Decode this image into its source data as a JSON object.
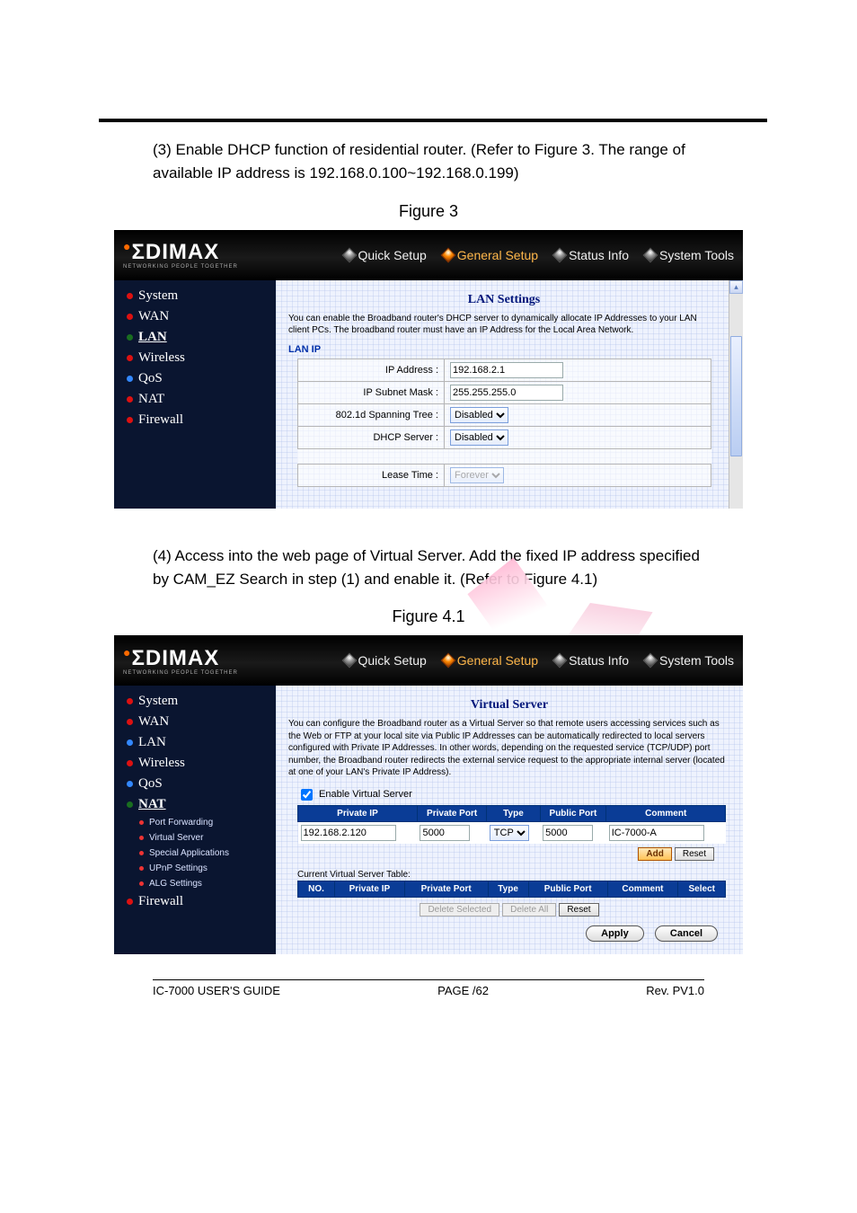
{
  "document": {
    "step3_text": "(3) Enable DHCP function of residential router. (Refer to Figure 3. The range of available IP address is 192.168.0.100~192.168.0.199)",
    "figure3_caption": "Figure 3",
    "step4_text": "(4) Access into the web page of Virtual Server. Add the fixed IP address specified by CAM_EZ Search in step (1) and enable it. (Refer to Figure 4.1)",
    "figure41_caption": "Figure 4.1",
    "footer_left": "IC-7000 USER'S GUIDE",
    "footer_center": "PAGE   /62",
    "footer_right": "Rev. PV1.0"
  },
  "router_common": {
    "logo_text": "ΣDIMAX",
    "logo_sub": "NETWORKING PEOPLE TOGETHER",
    "tabs": {
      "quick": "Quick Setup",
      "general": "General Setup",
      "status": "Status Info",
      "tools": "System Tools"
    },
    "nav": {
      "system": "System",
      "wan": "WAN",
      "lan": "LAN",
      "wireless": "Wireless",
      "qos": "QoS",
      "nat": "NAT",
      "firewall": "Firewall"
    }
  },
  "fig3": {
    "title": "LAN Settings",
    "desc": "You can enable the Broadband router's DHCP server to dynamically allocate IP Addresses to your LAN client PCs. The broadband router must have an IP Address for the Local Area Network.",
    "subhead": "LAN IP",
    "rows": {
      "ip_label": "IP Address :",
      "ip_value": "192.168.2.1",
      "mask_label": "IP Subnet Mask :",
      "mask_value": "255.255.255.0",
      "stp_label": "802.1d Spanning Tree :",
      "stp_value": "Disabled",
      "dhcp_label": "DHCP Server :",
      "dhcp_value": "Disabled",
      "lease_label": "Lease Time :",
      "lease_value": "Forever"
    }
  },
  "fig41": {
    "title": "Virtual Server",
    "desc": "You can configure the Broadband router as a Virtual Server so that remote users accessing services such as the Web or FTP at your local site via Public IP Addresses can be automatically redirected to local servers configured with Private IP Addresses. In other words, depending on the requested service (TCP/UDP) port number, the Broadband router redirects the external service request to the appropriate internal server (located at one of your LAN's Private IP Address).",
    "nat_sub": {
      "port_fwd": "Port Forwarding",
      "virtual_server": "Virtual Server",
      "special_apps": "Special Applications",
      "upnp": "UPnP Settings",
      "alg": "ALG Settings"
    },
    "enable_label": "Enable Virtual Server",
    "enable_checked": true,
    "cols": {
      "no": "NO.",
      "private_ip": "Private IP",
      "private_port": "Private Port",
      "type": "Type",
      "public_port": "Public Port",
      "comment": "Comment",
      "select": "Select"
    },
    "entry": {
      "private_ip": "192.168.2.120",
      "private_port": "5000",
      "type": "TCP",
      "public_port": "5000",
      "comment": "IC-7000-A"
    },
    "buttons": {
      "add": "Add",
      "reset": "Reset",
      "delete_selected": "Delete Selected",
      "delete_all": "Delete All",
      "reset2": "Reset",
      "apply": "Apply",
      "cancel": "Cancel"
    },
    "current_table_title": "Current Virtual Server Table:"
  }
}
